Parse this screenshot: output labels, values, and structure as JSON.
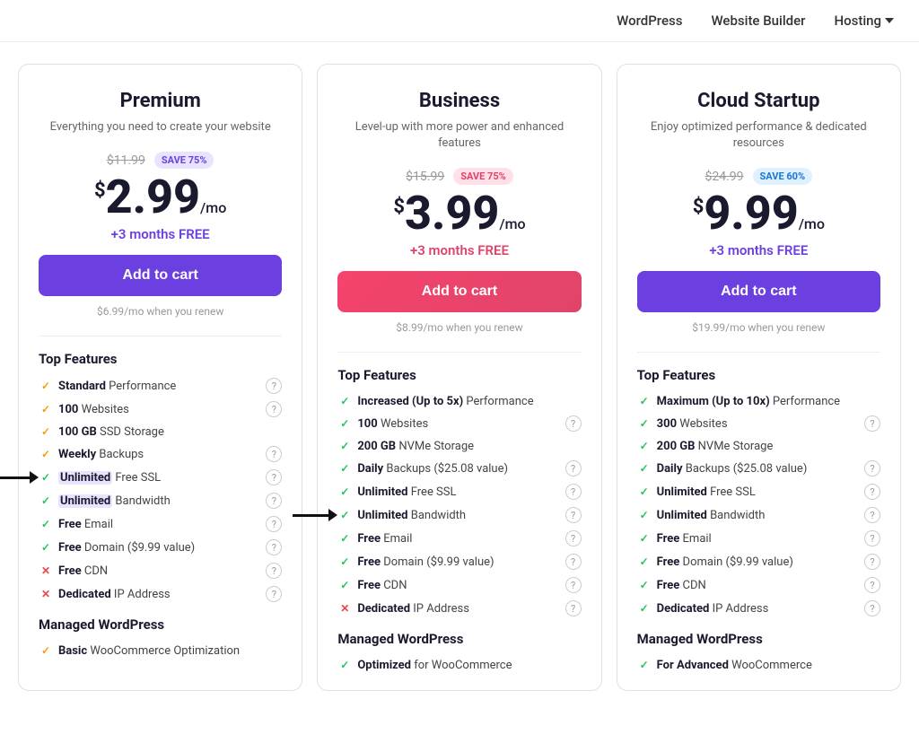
{
  "nav": {
    "items": [
      {
        "label": "WordPress",
        "arrow": false
      },
      {
        "label": "Website Builder",
        "arrow": false
      },
      {
        "label": "Hosting",
        "arrow": true
      }
    ]
  },
  "plans": [
    {
      "id": "premium",
      "title": "Premium",
      "subtitle": "Everything you need to create your website",
      "original_price": "$11.99",
      "save_badge": "SAVE 75%",
      "save_badge_style": "purple",
      "price_dollar": "$",
      "price_amount": "2.99",
      "price_mo": "/mo",
      "months_free": "+3 months FREE",
      "months_free_style": "purple",
      "btn_label": "Add to cart",
      "btn_style": "purple",
      "renew_text": "$6.99/mo when you renew",
      "features_title": "Top Features",
      "features": [
        {
          "icon": "check_yellow",
          "bold": "Standard",
          "text": " Performance",
          "info": true,
          "highlight": false,
          "arrow": false
        },
        {
          "icon": "check_yellow",
          "bold": "100",
          "text": " Websites",
          "info": true,
          "highlight": false,
          "arrow": false
        },
        {
          "icon": "check_yellow",
          "bold": "100 GB",
          "text": " SSD Storage",
          "info": false,
          "highlight": false,
          "arrow": false
        },
        {
          "icon": "check_yellow",
          "bold": "Weekly",
          "text": " Backups",
          "info": true,
          "highlight": false,
          "arrow": false
        },
        {
          "icon": "check_green",
          "bold": "Unlimited",
          "text": " Free SSL",
          "info": true,
          "highlight": true,
          "arrow": true
        },
        {
          "icon": "check_green",
          "bold": "Unlimited",
          "text": " Bandwidth",
          "info": true,
          "highlight": true,
          "arrow": false
        },
        {
          "icon": "check_green",
          "bold": "Free",
          "text": " Email",
          "info": true,
          "highlight": false,
          "arrow": false
        },
        {
          "icon": "check_green",
          "bold": "Free",
          "text": " Domain ($9.99 value)",
          "info": true,
          "highlight": false,
          "arrow": false
        },
        {
          "icon": "cross_red",
          "bold": "Free",
          "text": " CDN",
          "info": true,
          "highlight": false,
          "arrow": false
        },
        {
          "icon": "cross_red",
          "bold": "Dedicated",
          "text": " IP Address",
          "info": true,
          "highlight": false,
          "arrow": false
        }
      ],
      "managed_title": "Managed WordPress",
      "managed_features": [
        {
          "icon": "check_yellow",
          "bold": "Basic",
          "text": " WooCommerce Optimization"
        }
      ]
    },
    {
      "id": "business",
      "title": "Business",
      "subtitle": "Level-up with more power and enhanced features",
      "original_price": "$15.99",
      "save_badge": "SAVE 75%",
      "save_badge_style": "pink",
      "price_dollar": "$",
      "price_amount": "3.99",
      "price_mo": "/mo",
      "months_free": "+3 months FREE",
      "months_free_style": "pink",
      "btn_label": "Add to cart",
      "btn_style": "pink",
      "renew_text": "$8.99/mo when you renew",
      "features_title": "Top Features",
      "features": [
        {
          "icon": "check_green",
          "bold": "Increased (Up to 5x)",
          "text": " Performance",
          "info": false,
          "highlight": false,
          "arrow": false
        },
        {
          "icon": "check_green",
          "bold": "100",
          "text": " Websites",
          "info": true,
          "highlight": false,
          "arrow": false
        },
        {
          "icon": "check_green",
          "bold": "200 GB",
          "text": " NVMe Storage",
          "info": false,
          "highlight": false,
          "arrow": false
        },
        {
          "icon": "check_green",
          "bold": "Daily",
          "text": " Backups ($25.08 value)",
          "info": true,
          "highlight": false,
          "arrow": false
        },
        {
          "icon": "check_green",
          "bold": "Unlimited",
          "text": " Free SSL",
          "info": true,
          "highlight": false,
          "arrow": false
        },
        {
          "icon": "check_green",
          "bold": "Unlimited",
          "text": " Bandwidth",
          "info": true,
          "highlight": false,
          "arrow": true
        },
        {
          "icon": "check_green",
          "bold": "Free",
          "text": " Email",
          "info": true,
          "highlight": false,
          "arrow": false
        },
        {
          "icon": "check_green",
          "bold": "Free",
          "text": " Domain ($9.99 value)",
          "info": true,
          "highlight": false,
          "arrow": false
        },
        {
          "icon": "check_green",
          "bold": "Free",
          "text": " CDN",
          "info": true,
          "highlight": false,
          "arrow": false
        },
        {
          "icon": "cross_red",
          "bold": "Dedicated",
          "text": " IP Address",
          "info": true,
          "highlight": false,
          "arrow": false
        }
      ],
      "managed_title": "Managed WordPress",
      "managed_features": [
        {
          "icon": "check_green",
          "bold": "Optimized",
          "text": " for WooCommerce"
        }
      ]
    },
    {
      "id": "cloud-startup",
      "title": "Cloud Startup",
      "subtitle": "Enjoy optimized performance & dedicated resources",
      "original_price": "$24.99",
      "save_badge": "SAVE 60%",
      "save_badge_style": "blue",
      "price_dollar": "$",
      "price_amount": "9.99",
      "price_mo": "/mo",
      "months_free": "+3 months FREE",
      "months_free_style": "purple",
      "btn_label": "Add to cart",
      "btn_style": "purple",
      "renew_text": "$19.99/mo when you renew",
      "features_title": "Top Features",
      "features": [
        {
          "icon": "check_green",
          "bold": "Maximum (Up to 10x)",
          "text": " Performance",
          "info": false,
          "highlight": false,
          "arrow": false
        },
        {
          "icon": "check_green",
          "bold": "300",
          "text": " Websites",
          "info": true,
          "highlight": false,
          "arrow": false
        },
        {
          "icon": "check_green",
          "bold": "200 GB",
          "text": " NVMe Storage",
          "info": false,
          "highlight": false,
          "arrow": false
        },
        {
          "icon": "check_green",
          "bold": "Daily",
          "text": " Backups ($25.08 value)",
          "info": true,
          "highlight": false,
          "arrow": false
        },
        {
          "icon": "check_green",
          "bold": "Unlimited",
          "text": " Free SSL",
          "info": true,
          "highlight": false,
          "arrow": false
        },
        {
          "icon": "check_green",
          "bold": "Unlimited",
          "text": " Bandwidth",
          "info": true,
          "highlight": false,
          "arrow": false
        },
        {
          "icon": "check_green",
          "bold": "Free",
          "text": " Email",
          "info": true,
          "highlight": false,
          "arrow": false
        },
        {
          "icon": "check_green",
          "bold": "Free",
          "text": " Domain ($9.99 value)",
          "info": true,
          "highlight": false,
          "arrow": false
        },
        {
          "icon": "check_green",
          "bold": "Free",
          "text": " CDN",
          "info": true,
          "highlight": false,
          "arrow": false
        },
        {
          "icon": "check_green",
          "bold": "Dedicated",
          "text": " IP Address",
          "info": true,
          "highlight": false,
          "arrow": false
        }
      ],
      "managed_title": "Managed WordPress",
      "managed_features": [
        {
          "icon": "check_green",
          "bold": "For Advanced",
          "text": " WooCommerce"
        }
      ]
    }
  ]
}
